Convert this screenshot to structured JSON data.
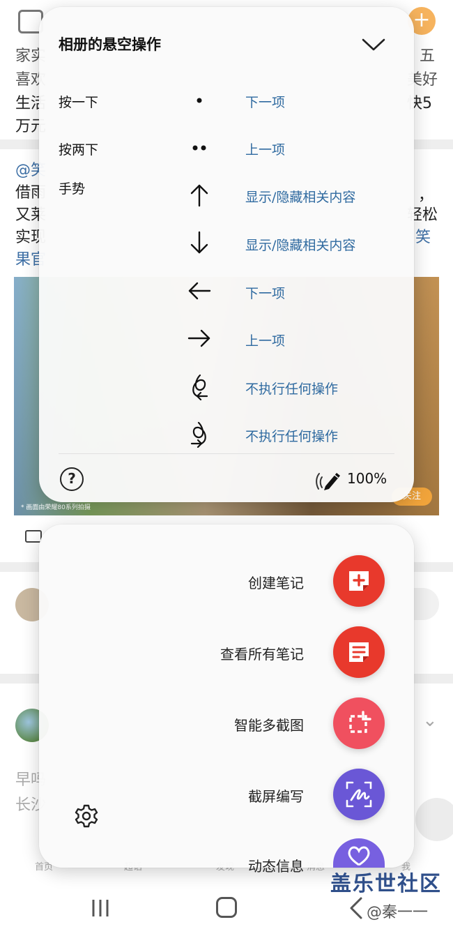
{
  "hover_panel": {
    "title": "相册的悬空操作",
    "rows": [
      {
        "label": "按一下",
        "gesture": "single-press-icon",
        "action": "下一项"
      },
      {
        "label": "按两下",
        "gesture": "double-press-icon",
        "action": "上一项"
      },
      {
        "label": "手势",
        "gesture": "arrow-up-icon",
        "action": "显示/隐藏相关内容"
      },
      {
        "label": "",
        "gesture": "arrow-down-icon",
        "action": "显示/隐藏相关内容"
      },
      {
        "label": "",
        "gesture": "arrow-left-icon",
        "action": "下一项"
      },
      {
        "label": "",
        "gesture": "arrow-right-icon",
        "action": "上一项"
      },
      {
        "label": "",
        "gesture": "loop-left-icon",
        "action": "不执行任何操作"
      },
      {
        "label": "",
        "gesture": "loop-right-icon",
        "action": "不执行任何操作"
      }
    ],
    "pen_level": "100%"
  },
  "air_command": {
    "items": [
      {
        "label": "创建笔记",
        "icon": "create-note-icon",
        "color": "#e8392c"
      },
      {
        "label": "查看所有笔记",
        "icon": "view-notes-icon",
        "color": "#e8392c"
      },
      {
        "label": "智能多截图",
        "icon": "smart-select-icon",
        "color": "#f0505f"
      },
      {
        "label": "截屏编写",
        "icon": "screen-write-icon",
        "color": "#6a57d6"
      },
      {
        "label": "动态信息",
        "icon": "live-message-icon",
        "color": "#7760e0"
      }
    ]
  },
  "background": {
    "lines": [
      "家实",
      "喜欢",
      "生活",
      "万元",
      "@笑",
      "借雨",
      "又莱",
      "实现",
      "果官",
      "五",
      "美好",
      "快5",
      "，",
      "轻松",
      "笑",
      "早吗",
      "长沙"
    ],
    "video_follow": "关注",
    "video_caption": "* 画面由荣耀80系列拍摄",
    "tabs": [
      "首页",
      "超话",
      "发现",
      "消息",
      "我"
    ]
  },
  "watermark": {
    "main": "盖乐世社区",
    "sub": "@秦一一"
  },
  "colors": {
    "action_blue": "#2f6aa0",
    "panel_bg": "#fafafa"
  }
}
